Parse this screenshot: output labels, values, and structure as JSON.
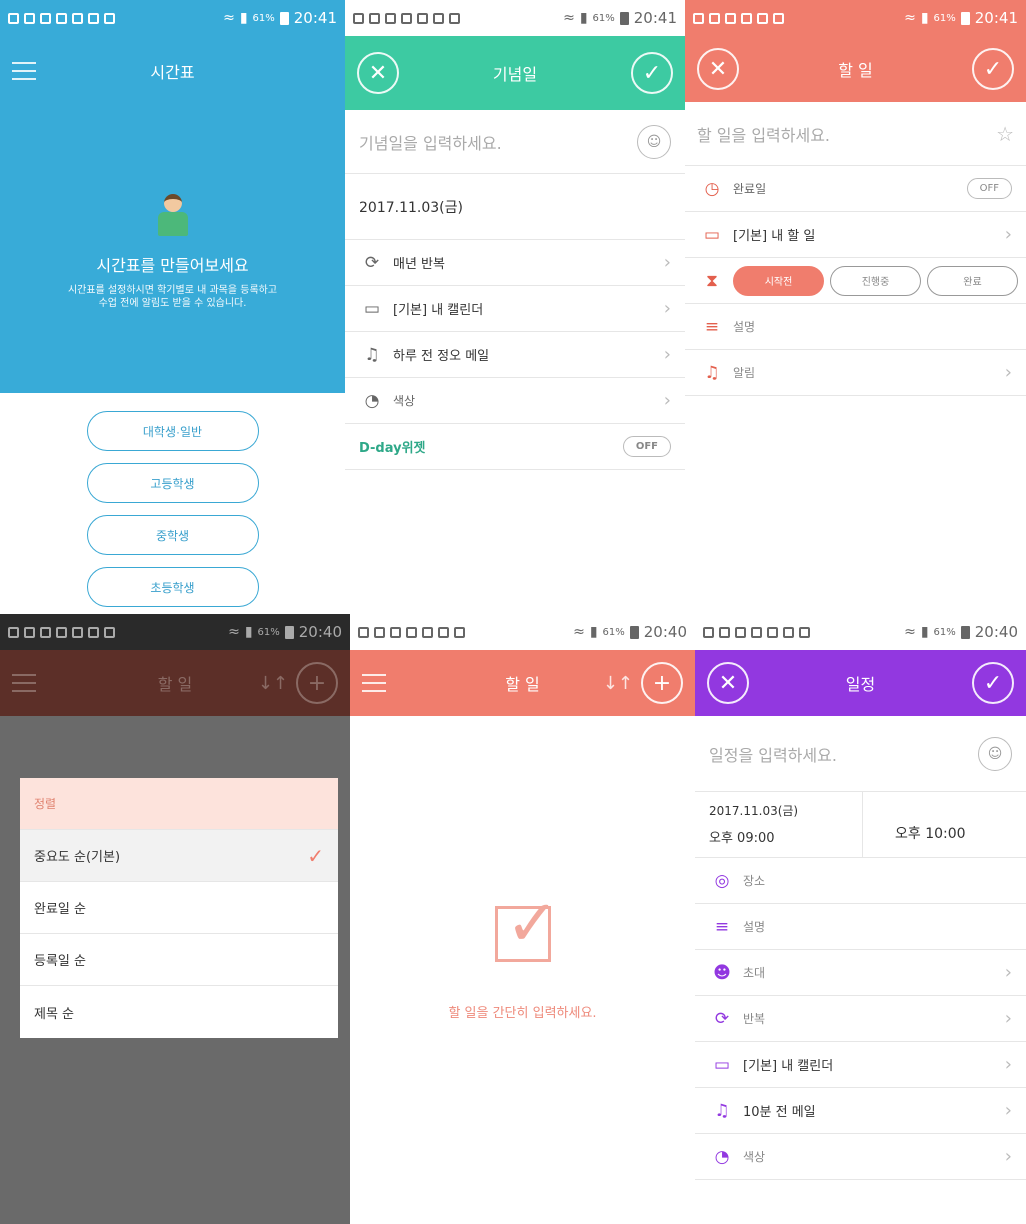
{
  "p1": {
    "status_time": "20:41",
    "status_battery": "61%",
    "title": "시간표",
    "hero_title": "시간표를 만들어보세요",
    "hero_desc_1": "시간표를 설정하시면 학기별로 내 과목을 등록하고",
    "hero_desc_2": "수업 전에 알림도 받을 수 있습니다.",
    "levels": [
      "대학생·일반",
      "고등학생",
      "중학생",
      "초등학생"
    ],
    "accent": "#38abd8"
  },
  "p2": {
    "status_time": "20:41",
    "status_battery": "61%",
    "title": "기념일",
    "input_placeholder": "기념일을 입력하세요.",
    "date": "2017.11.03(금)",
    "repeat": "매년 반복",
    "calendar": "[기본] 내 캘린더",
    "alert": "하루 전 정오 메일",
    "color": "색상",
    "dday": "D-day위젯",
    "dday_toggle": "OFF",
    "accent": "#3dcaa2"
  },
  "p3": {
    "status_time": "20:41",
    "status_battery": "61%",
    "title": "할 일",
    "input_placeholder": "할 일을 입력하세요.",
    "due": "완료일",
    "due_toggle": "OFF",
    "list": "[기본] 내 할 일",
    "status_options": [
      "시작전",
      "진행중",
      "완료"
    ],
    "desc": "설명",
    "alarm": "알림",
    "accent": "#f07d6d"
  },
  "p4": {
    "status_time": "20:40",
    "status_battery": "61%",
    "title": "할 일",
    "sheet_title": "정렬",
    "options": [
      "중요도 순(기본)",
      "완료일 순",
      "등록일 순",
      "제목 순"
    ]
  },
  "p5": {
    "status_time": "20:40",
    "status_battery": "61%",
    "title": "할 일",
    "empty_text": "할 일을 간단히 입력하세요."
  },
  "p6": {
    "status_time": "20:40",
    "status_battery": "61%",
    "title": "일정",
    "input_placeholder": "일정을 입력하세요.",
    "date": "2017.11.03(금)",
    "start": "오후 09:00",
    "end": "오후 10:00",
    "place": "장소",
    "desc": "설명",
    "invite": "초대",
    "repeat": "반복",
    "calendar": "[기본] 내 캘린더",
    "alert": "10분 전 메일",
    "color": "색상",
    "accent": "#9238e0"
  }
}
